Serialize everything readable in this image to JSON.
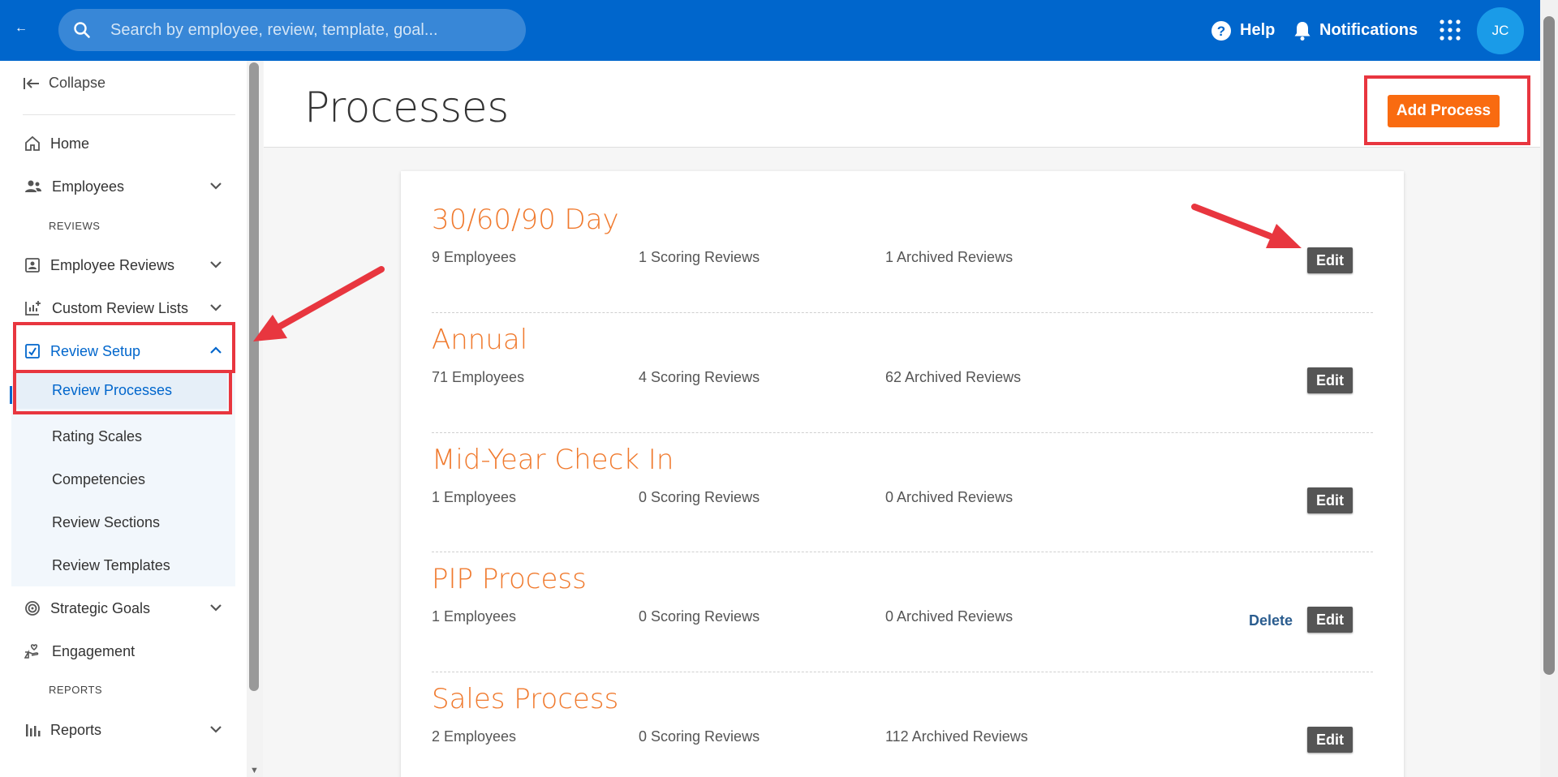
{
  "topbar": {
    "back_icon": "back-arrow-icon",
    "search_placeholder": "Search by employee, review, template, goal...",
    "help_label": "Help",
    "notifications_label": "Notifications",
    "avatar_initials": "JC",
    "brand_color": "#0066cc"
  },
  "sidebar": {
    "collapse_label": "Collapse",
    "items": {
      "home": "Home",
      "employees": "Employees",
      "reviews_section": "REVIEWS",
      "employee_reviews": "Employee Reviews",
      "custom_review_lists": "Custom Review Lists",
      "review_setup": "Review Setup",
      "review_processes": "Review Processes",
      "rating_scales": "Rating Scales",
      "competencies": "Competencies",
      "review_sections": "Review Sections",
      "review_templates": "Review Templates",
      "strategic_goals": "Strategic Goals",
      "engagement": "Engagement",
      "reports_section": "REPORTS",
      "reports": "Reports"
    }
  },
  "main": {
    "title": "Processes",
    "add_button": "Add Process",
    "accent_color": "#f96b10",
    "processes": [
      {
        "name": "30/60/90 Day",
        "employees": "9 Employees",
        "scoring": "1 Scoring Reviews",
        "archived": "1 Archived Reviews",
        "edit": "Edit"
      },
      {
        "name": "Annual",
        "employees": "71 Employees",
        "scoring": "4 Scoring Reviews",
        "archived": "62 Archived Reviews",
        "edit": "Edit"
      },
      {
        "name": "Mid-Year Check In",
        "employees": "1 Employees",
        "scoring": "0 Scoring Reviews",
        "archived": "0 Archived Reviews",
        "edit": "Edit"
      },
      {
        "name": "PIP Process",
        "employees": "1 Employees",
        "scoring": "0 Scoring Reviews",
        "archived": "0 Archived Reviews",
        "edit": "Edit",
        "delete": "Delete"
      },
      {
        "name": "Sales Process",
        "employees": "2 Employees",
        "scoring": "0 Scoring Reviews",
        "archived": "112 Archived Reviews",
        "edit": "Edit"
      }
    ]
  },
  "annotation_color": "#e8363f"
}
